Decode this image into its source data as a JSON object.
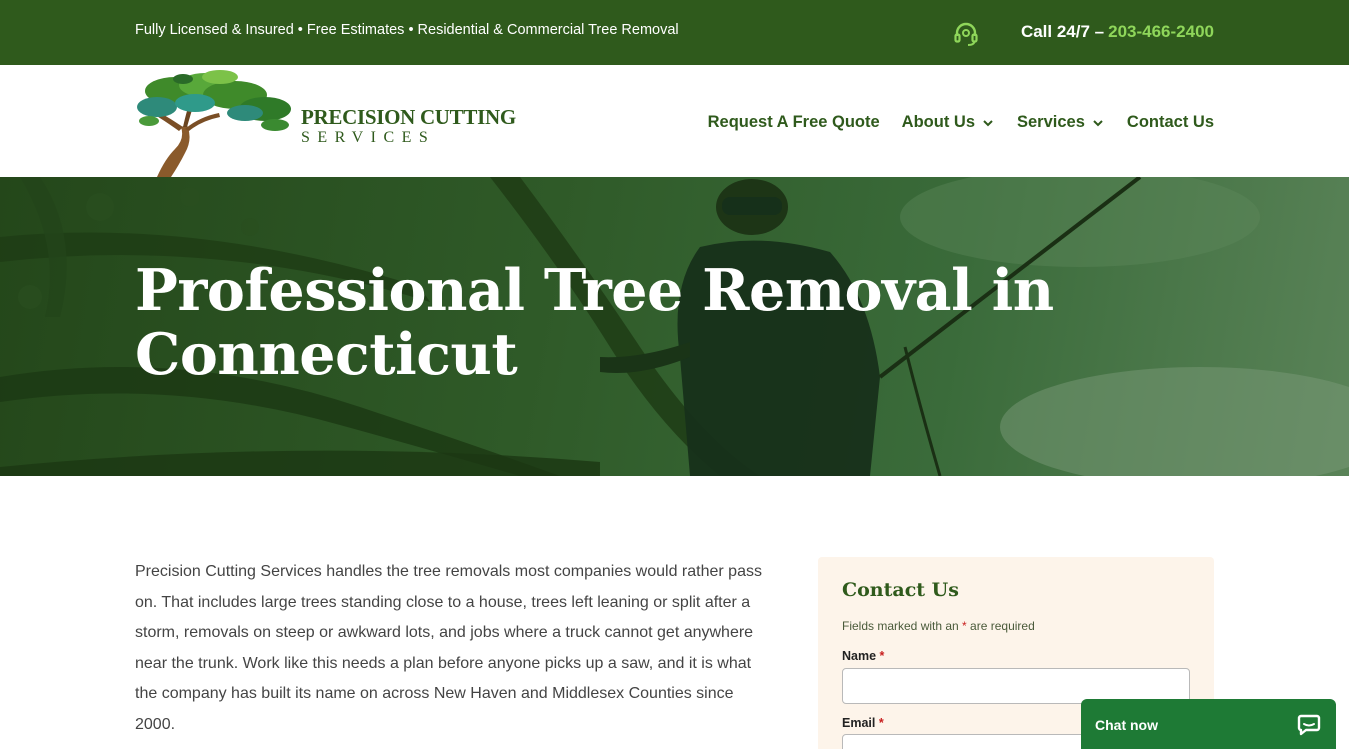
{
  "topbar": {
    "info": "Fully Licensed & Insured • Free Estimates • Residential & Commercial Tree Removal",
    "call_label": "Call 24/7 –",
    "phone": "203-466-2400",
    "support_icon": "headset-icon"
  },
  "logo": {
    "name": "PRECISION CUTTING",
    "sub": "SERVICES"
  },
  "nav": {
    "items": [
      {
        "label": "Request A Free Quote",
        "dropdown": false
      },
      {
        "label": "About Us",
        "dropdown": true
      },
      {
        "label": "Services",
        "dropdown": true
      },
      {
        "label": "Contact Us",
        "dropdown": false
      }
    ]
  },
  "hero": {
    "title": "Professional Tree Removal in Connecticut"
  },
  "intro": {
    "text": "Precision Cutting Services handles the tree removals most companies would rather pass on. That includes large trees standing close to a house, trees left leaning or split after a storm, removals on steep or awkward lots, and jobs where a truck cannot get anywhere near the trunk. Work like this needs a plan before anyone picks up a saw, and it is what the company has built its name on across New Haven and Middlesex Counties since 2000."
  },
  "contact": {
    "title": "Contact Us",
    "note_before": "Fields marked with an ",
    "note_star": "*",
    "note_after": " are required",
    "fields": [
      {
        "label": "Name",
        "required": "*",
        "value": ""
      },
      {
        "label": "Email",
        "required": "*",
        "value": ""
      }
    ]
  },
  "chat": {
    "label": "Chat now",
    "icon": "chat-bubble-icon"
  },
  "colors": {
    "brand_green": "#2f5a1c",
    "phone_accent": "#8fd65a",
    "chat_green": "#1e7a35",
    "card_bg": "#fdf4ea"
  }
}
